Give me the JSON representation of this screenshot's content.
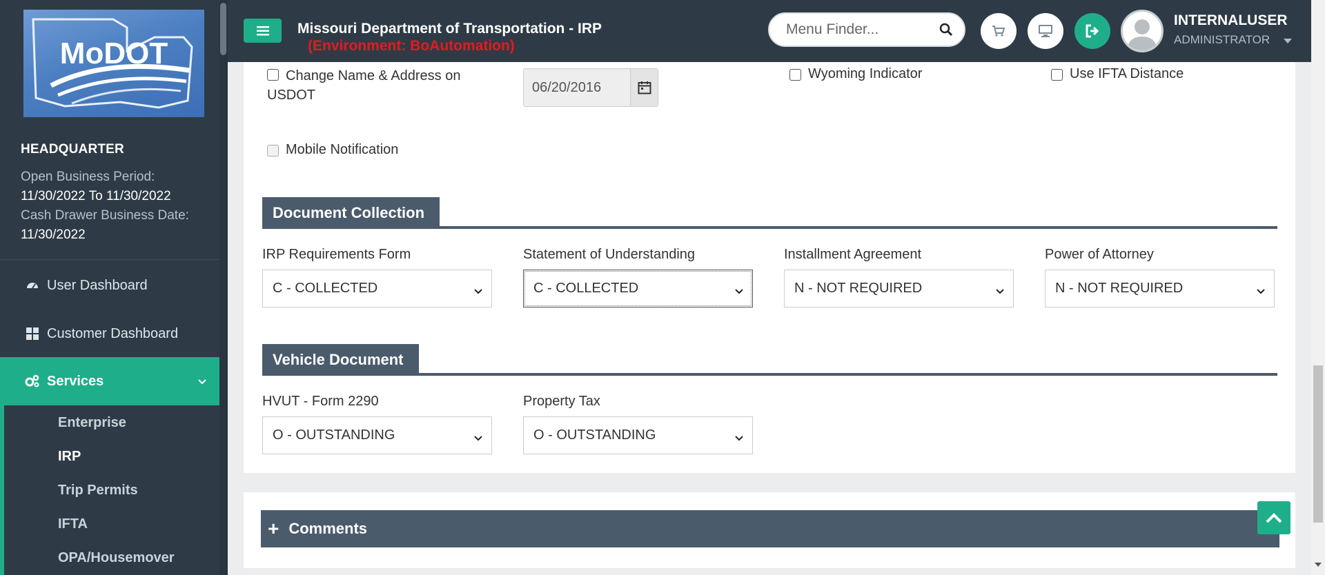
{
  "sidebar": {
    "logo_text": "MoDOT",
    "location": "HEADQUARTER",
    "open_period_label": "Open Business Period:",
    "open_period_value": "11/30/2022 To 11/30/2022",
    "cash_drawer_label": "Cash Drawer Business Date:",
    "cash_drawer_value": "11/30/2022",
    "nav": [
      {
        "label": "User Dashboard",
        "icon": "dashboard-icon"
      },
      {
        "label": "Customer Dashboard",
        "icon": "grid-icon"
      },
      {
        "label": "Services",
        "icon": "cogs-icon"
      }
    ],
    "sub_items": [
      "Enterprise",
      "IRP",
      "Trip Permits",
      "IFTA",
      "OPA/Housemover"
    ],
    "active_sub": "IRP"
  },
  "header": {
    "title": "Missouri Department of Transportation - IRP",
    "environment": "(Environment: BoAutomation)",
    "search_placeholder": "Menu Finder...",
    "user_name": "INTERNALUSER",
    "user_role": "ADMINISTRATOR"
  },
  "form": {
    "change_name_label": "Change Name & Address on",
    "change_name_label2": "USDOT",
    "date_value": "06/20/2016",
    "wyoming_label": "Wyoming Indicator",
    "ifta_distance_label": "Use IFTA Distance",
    "mobile_label": "Mobile Notification"
  },
  "document_collection": {
    "title": "Document Collection",
    "fields": [
      {
        "label": "IRP Requirements Form",
        "value": "C - COLLECTED"
      },
      {
        "label": "Statement of Understanding",
        "value": "C - COLLECTED"
      },
      {
        "label": "Installment Agreement",
        "value": "N - NOT REQUIRED"
      },
      {
        "label": "Power of Attorney",
        "value": "N - NOT REQUIRED"
      }
    ]
  },
  "vehicle_document": {
    "title": "Vehicle Document",
    "fields": [
      {
        "label": "HVUT - Form 2290",
        "value": "O - OUTSTANDING"
      },
      {
        "label": "Property Tax",
        "value": "O - OUTSTANDING"
      }
    ]
  },
  "comments": {
    "label": "Comments"
  },
  "colors": {
    "accent": "#1fae8a",
    "sidebar": "#2e3b46",
    "section": "#4a5b6c",
    "env_text": "#e6191f"
  }
}
